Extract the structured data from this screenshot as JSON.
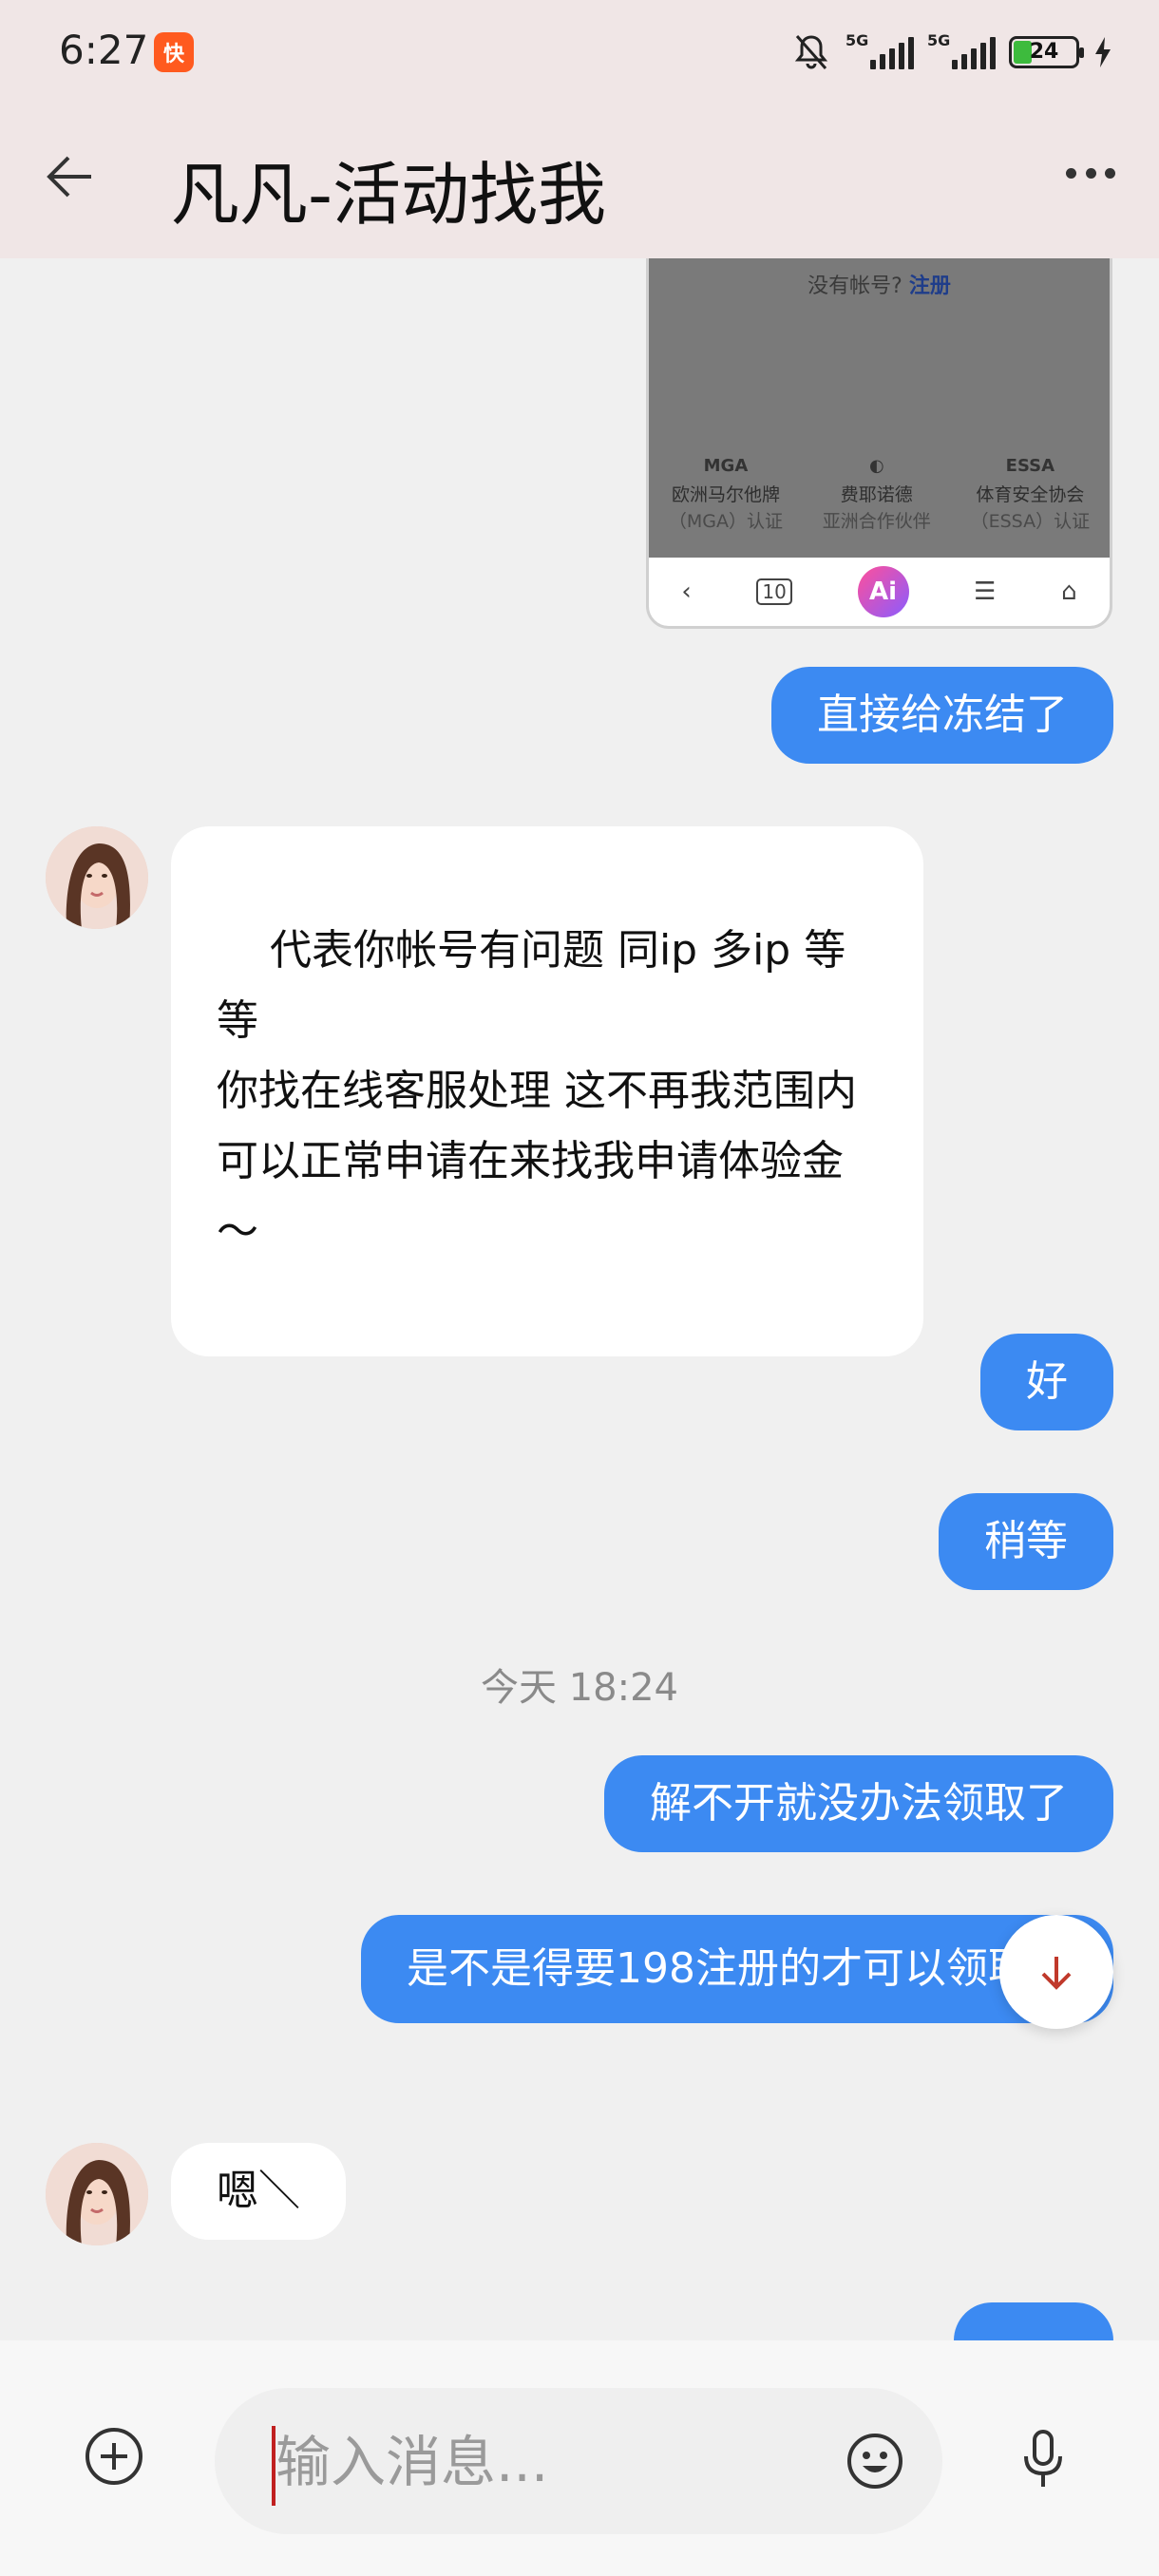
{
  "status_bar": {
    "time": "6:27",
    "app_badge": "快",
    "network_1": "5G",
    "network_2": "5G",
    "battery": "24"
  },
  "header": {
    "title": "凡凡-活动找我"
  },
  "screenshot_preview": {
    "register_prompt": "没有帐号?",
    "register_link": "注册",
    "badges": [
      {
        "logo": "MGA",
        "line1": "欧洲马尔他牌",
        "line2": "（MGA）认证"
      },
      {
        "logo": "◐",
        "line1": "费耶诺德",
        "line2": "亚洲合作伙伴"
      },
      {
        "logo": "ESSA",
        "line1": "体育安全协会",
        "line2": "（ESSA）认证"
      }
    ],
    "nav": {
      "back": "‹",
      "tabs": "10",
      "ai": "Ai",
      "menu": "☰",
      "home": "⌂"
    }
  },
  "messages": [
    {
      "side": "out",
      "text": "直接给冻结了"
    },
    {
      "side": "in",
      "text": "代表你帐号有问题 同ip 多ip 等等\n你找在线客服处理 这不再我范围内\n可以正常申请在来找我申请体验金～"
    },
    {
      "side": "out",
      "text": "好"
    },
    {
      "side": "out",
      "text": "稍等"
    },
    {
      "side": "out",
      "text": "解不开就没办法领取了"
    },
    {
      "side": "out",
      "text": "是不是得要198注册的才可以领取"
    },
    {
      "side": "in",
      "text": "嗯＼"
    }
  ],
  "timestamp": "今天 18:24",
  "input": {
    "placeholder": "输入消息..."
  },
  "colors": {
    "outgoing_bubble": "#3c8af2",
    "incoming_bubble": "#ffffff",
    "header_bg": "#f0e6e6",
    "chat_bg": "#f0f0f0"
  }
}
